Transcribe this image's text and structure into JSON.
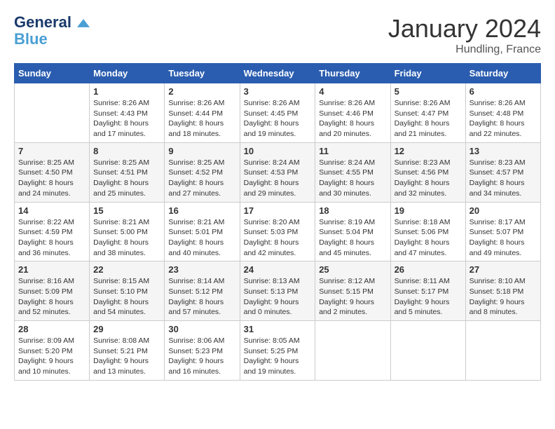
{
  "logo": {
    "line1": "General",
    "line2": "Blue"
  },
  "title": "January 2024",
  "location": "Hundling, France",
  "days_of_week": [
    "Sunday",
    "Monday",
    "Tuesday",
    "Wednesday",
    "Thursday",
    "Friday",
    "Saturday"
  ],
  "weeks": [
    [
      {
        "day": "",
        "info": ""
      },
      {
        "day": "1",
        "info": "Sunrise: 8:26 AM\nSunset: 4:43 PM\nDaylight: 8 hours\nand 17 minutes."
      },
      {
        "day": "2",
        "info": "Sunrise: 8:26 AM\nSunset: 4:44 PM\nDaylight: 8 hours\nand 18 minutes."
      },
      {
        "day": "3",
        "info": "Sunrise: 8:26 AM\nSunset: 4:45 PM\nDaylight: 8 hours\nand 19 minutes."
      },
      {
        "day": "4",
        "info": "Sunrise: 8:26 AM\nSunset: 4:46 PM\nDaylight: 8 hours\nand 20 minutes."
      },
      {
        "day": "5",
        "info": "Sunrise: 8:26 AM\nSunset: 4:47 PM\nDaylight: 8 hours\nand 21 minutes."
      },
      {
        "day": "6",
        "info": "Sunrise: 8:26 AM\nSunset: 4:48 PM\nDaylight: 8 hours\nand 22 minutes."
      }
    ],
    [
      {
        "day": "7",
        "info": ""
      },
      {
        "day": "8",
        "info": "Sunrise: 8:25 AM\nSunset: 4:51 PM\nDaylight: 8 hours\nand 25 minutes."
      },
      {
        "day": "9",
        "info": "Sunrise: 8:25 AM\nSunset: 4:52 PM\nDaylight: 8 hours\nand 27 minutes."
      },
      {
        "day": "10",
        "info": "Sunrise: 8:24 AM\nSunset: 4:53 PM\nDaylight: 8 hours\nand 29 minutes."
      },
      {
        "day": "11",
        "info": "Sunrise: 8:24 AM\nSunset: 4:55 PM\nDaylight: 8 hours\nand 30 minutes."
      },
      {
        "day": "12",
        "info": "Sunrise: 8:23 AM\nSunset: 4:56 PM\nDaylight: 8 hours\nand 32 minutes."
      },
      {
        "day": "13",
        "info": "Sunrise: 8:23 AM\nSunset: 4:57 PM\nDaylight: 8 hours\nand 34 minutes."
      }
    ],
    [
      {
        "day": "14",
        "info": ""
      },
      {
        "day": "15",
        "info": "Sunrise: 8:21 AM\nSunset: 5:00 PM\nDaylight: 8 hours\nand 38 minutes."
      },
      {
        "day": "16",
        "info": "Sunrise: 8:21 AM\nSunset: 5:01 PM\nDaylight: 8 hours\nand 40 minutes."
      },
      {
        "day": "17",
        "info": "Sunrise: 8:20 AM\nSunset: 5:03 PM\nDaylight: 8 hours\nand 42 minutes."
      },
      {
        "day": "18",
        "info": "Sunrise: 8:19 AM\nSunset: 5:04 PM\nDaylight: 8 hours\nand 45 minutes."
      },
      {
        "day": "19",
        "info": "Sunrise: 8:18 AM\nSunset: 5:06 PM\nDaylight: 8 hours\nand 47 minutes."
      },
      {
        "day": "20",
        "info": "Sunrise: 8:17 AM\nSunset: 5:07 PM\nDaylight: 8 hours\nand 49 minutes."
      }
    ],
    [
      {
        "day": "21",
        "info": ""
      },
      {
        "day": "22",
        "info": "Sunrise: 8:15 AM\nSunset: 5:10 PM\nDaylight: 8 hours\nand 54 minutes."
      },
      {
        "day": "23",
        "info": "Sunrise: 8:14 AM\nSunset: 5:12 PM\nDaylight: 8 hours\nand 57 minutes."
      },
      {
        "day": "24",
        "info": "Sunrise: 8:13 AM\nSunset: 5:13 PM\nDaylight: 9 hours\nand 0 minutes."
      },
      {
        "day": "25",
        "info": "Sunrise: 8:12 AM\nSunset: 5:15 PM\nDaylight: 9 hours\nand 2 minutes."
      },
      {
        "day": "26",
        "info": "Sunrise: 8:11 AM\nSunset: 5:17 PM\nDaylight: 9 hours\nand 5 minutes."
      },
      {
        "day": "27",
        "info": "Sunrise: 8:10 AM\nSunset: 5:18 PM\nDaylight: 9 hours\nand 8 minutes."
      }
    ],
    [
      {
        "day": "28",
        "info": ""
      },
      {
        "day": "29",
        "info": "Sunrise: 8:08 AM\nSunset: 5:21 PM\nDaylight: 9 hours\nand 13 minutes."
      },
      {
        "day": "30",
        "info": "Sunrise: 8:06 AM\nSunset: 5:23 PM\nDaylight: 9 hours\nand 16 minutes."
      },
      {
        "day": "31",
        "info": "Sunrise: 8:05 AM\nSunset: 5:25 PM\nDaylight: 9 hours\nand 19 minutes."
      },
      {
        "day": "",
        "info": ""
      },
      {
        "day": "",
        "info": ""
      },
      {
        "day": "",
        "info": ""
      }
    ]
  ],
  "week1_sunday": "Sunrise: 8:25 AM\nSunset: 4:50 PM\nDaylight: 8 hours\nand 24 minutes.",
  "week2_sunday": "Sunrise: 8:22 AM\nSunset: 4:59 PM\nDaylight: 8 hours\nand 36 minutes.",
  "week3_sunday": "Sunrise: 8:16 AM\nSunset: 5:09 PM\nDaylight: 8 hours\nand 52 minutes.",
  "week4_sunday": "Sunrise: 8:09 AM\nSunset: 5:20 PM\nDaylight: 9 hours\nand 10 minutes."
}
